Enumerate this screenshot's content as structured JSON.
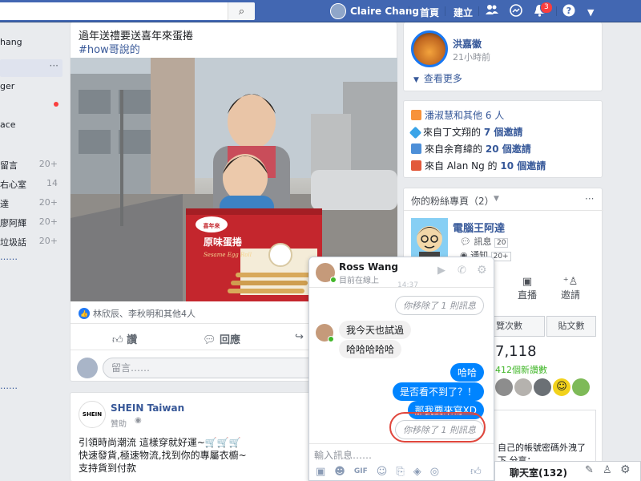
{
  "topbar": {
    "user_name": "Claire Chang",
    "home": "首頁",
    "create": "建立",
    "notification_count": "3"
  },
  "left_nav": {
    "items": [
      {
        "label": "hang",
        "count": ""
      },
      {
        "label": "ger",
        "count": ""
      },
      {
        "label": "ace",
        "count": ""
      },
      {
        "label": "留言",
        "count": "20+"
      },
      {
        "label": "右心室",
        "count": "14"
      },
      {
        "label": "達",
        "count": "20+"
      },
      {
        "label": "廖阿輝",
        "count": "20+"
      },
      {
        "label": "垃圾話",
        "count": "20+"
      }
    ],
    "more": "……",
    "more2": "……"
  },
  "post1": {
    "text": "過年送禮要送喜年來蛋捲",
    "hashtag": "#how哥說的",
    "box_brand": "喜年來",
    "box_product": "原味蛋捲",
    "box_sub": "Sesame Egg Roll",
    "reactions": "林欣辰、李秋明和其他4人",
    "like": "讚",
    "comment": "回應",
    "comment_placeholder": "留言……"
  },
  "post2": {
    "page": "SHEIN Taiwan",
    "sponsored": "贊助",
    "logo": "SHEIN",
    "line1": "引領時尚潮流 這樣穿就好運~🛒🛒🛒",
    "line2": "快速發貨,極速物流,找到你的專屬衣櫥~",
    "line3": "支持貨到付款"
  },
  "right": {
    "friend_name": "洪嘉徽",
    "friend_time": "21小時前",
    "see_more": "查看更多",
    "birthday": "潘淑慧和其他 6 人",
    "invite1_pre": "來自丁文翔的",
    "invite1_num": "7 個邀請",
    "invite2_pre": "來自余育緯的",
    "invite2_num": "20 個邀請",
    "invite3_pre": "來自 Alan Ng 的",
    "invite3_num": "10 個邀請",
    "pages_header": "你的粉絲專頁（2）",
    "page_name": "電腦王阿達",
    "messages": "訊息",
    "messages_count": "20",
    "notifications": "通知",
    "notifications_count": "20+",
    "live": "直播",
    "invite": "邀請",
    "views": "覽次數",
    "posts": "貼文數",
    "likes_number": "7,118",
    "new_likes": "412個新讚數",
    "promo": "自己的帳號密碼外洩了",
    "promo2": "下 分享："
  },
  "chat": {
    "name": "Ross Wang",
    "status": "目前在線上",
    "time": "14:37",
    "removed1": "你移除了 1 則訊息",
    "in1": "我今天也試過",
    "in2": "哈哈哈哈哈",
    "out1": "哈哈",
    "out2": "是否看不到了？！",
    "out3": "那我要來寫XD",
    "removed2": "你移除了 1 則訊息",
    "input_placeholder": "輸入訊息……"
  },
  "chatbar": {
    "label": "聊天室(132)"
  },
  "colors": {
    "brand": "#4267b2",
    "messenger": "#0084ff",
    "badge": "#fa3e3e",
    "highlight_circle": "#e0463c"
  }
}
